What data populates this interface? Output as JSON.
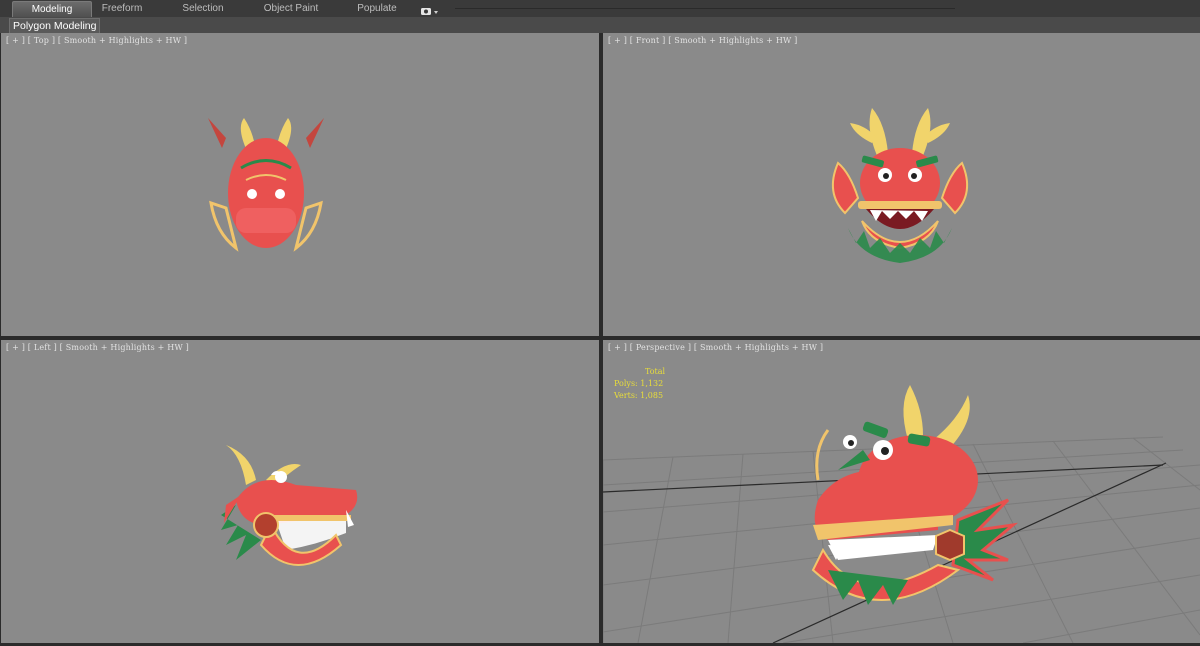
{
  "ribbon": {
    "tabs": [
      "Modeling",
      "Freeform",
      "Selection",
      "Object Paint",
      "Populate"
    ],
    "active_tab": "Modeling",
    "panel_label": "Polygon Modeling",
    "options_icon": "video-camera-dropdown-icon"
  },
  "viewports": {
    "top": {
      "label": "[ + ] [ Top ] [ Smooth + Highlights + HW ]"
    },
    "front": {
      "label": "[ + ] [ Front ] [ Smooth + Highlights + HW ]"
    },
    "left": {
      "label": "[ + ] [ Left ] [ Smooth + Highlights + HW ]"
    },
    "perspective": {
      "label": "[ + ] [ Perspective ] [ Smooth + Highlights + HW ]",
      "stats": {
        "header": "Total",
        "polys": "Polys: 1,132",
        "verts": "Verts: 1,085"
      }
    }
  },
  "colors": {
    "viewport_bg": "#8a8a8a",
    "dragon_red": "#e8504e",
    "dragon_gold": "#f1c46b",
    "dragon_green": "#2a8a4a",
    "stats_text": "#e8dd3a"
  }
}
